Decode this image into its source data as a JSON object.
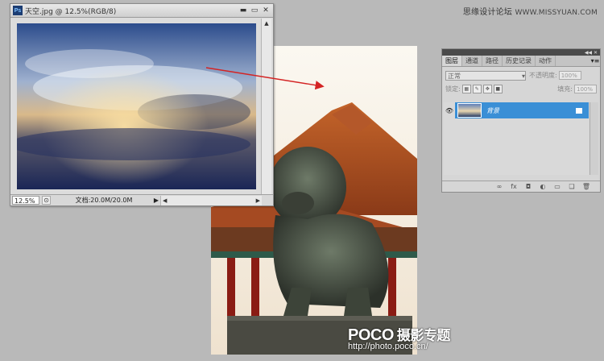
{
  "watermark": {
    "title": "思缘设计论坛",
    "site": "WWW.MISSYUAN.COM"
  },
  "doc_window": {
    "title": "天空.jpg @ 12.5%(RGB/8)",
    "zoom": "12.5%",
    "doc_info": "文档:20.0M/20.0M"
  },
  "layers_panel": {
    "tabs": [
      "图层",
      "通道",
      "路径",
      "历史记录",
      "动作"
    ],
    "blend_mode": "正常",
    "opacity_label": "不透明度:",
    "opacity_value": "100%",
    "lock_label": "锁定:",
    "fill_label": "填充:",
    "fill_value": "100%",
    "layers": [
      {
        "name": "背景"
      }
    ]
  },
  "photo_logo": {
    "brand": "POCO",
    "subtitle": "摄影专题",
    "url": "http://photo.poco.cn/"
  },
  "colors": {
    "selection": "#3a8fd6",
    "arrow": "#d42424"
  }
}
